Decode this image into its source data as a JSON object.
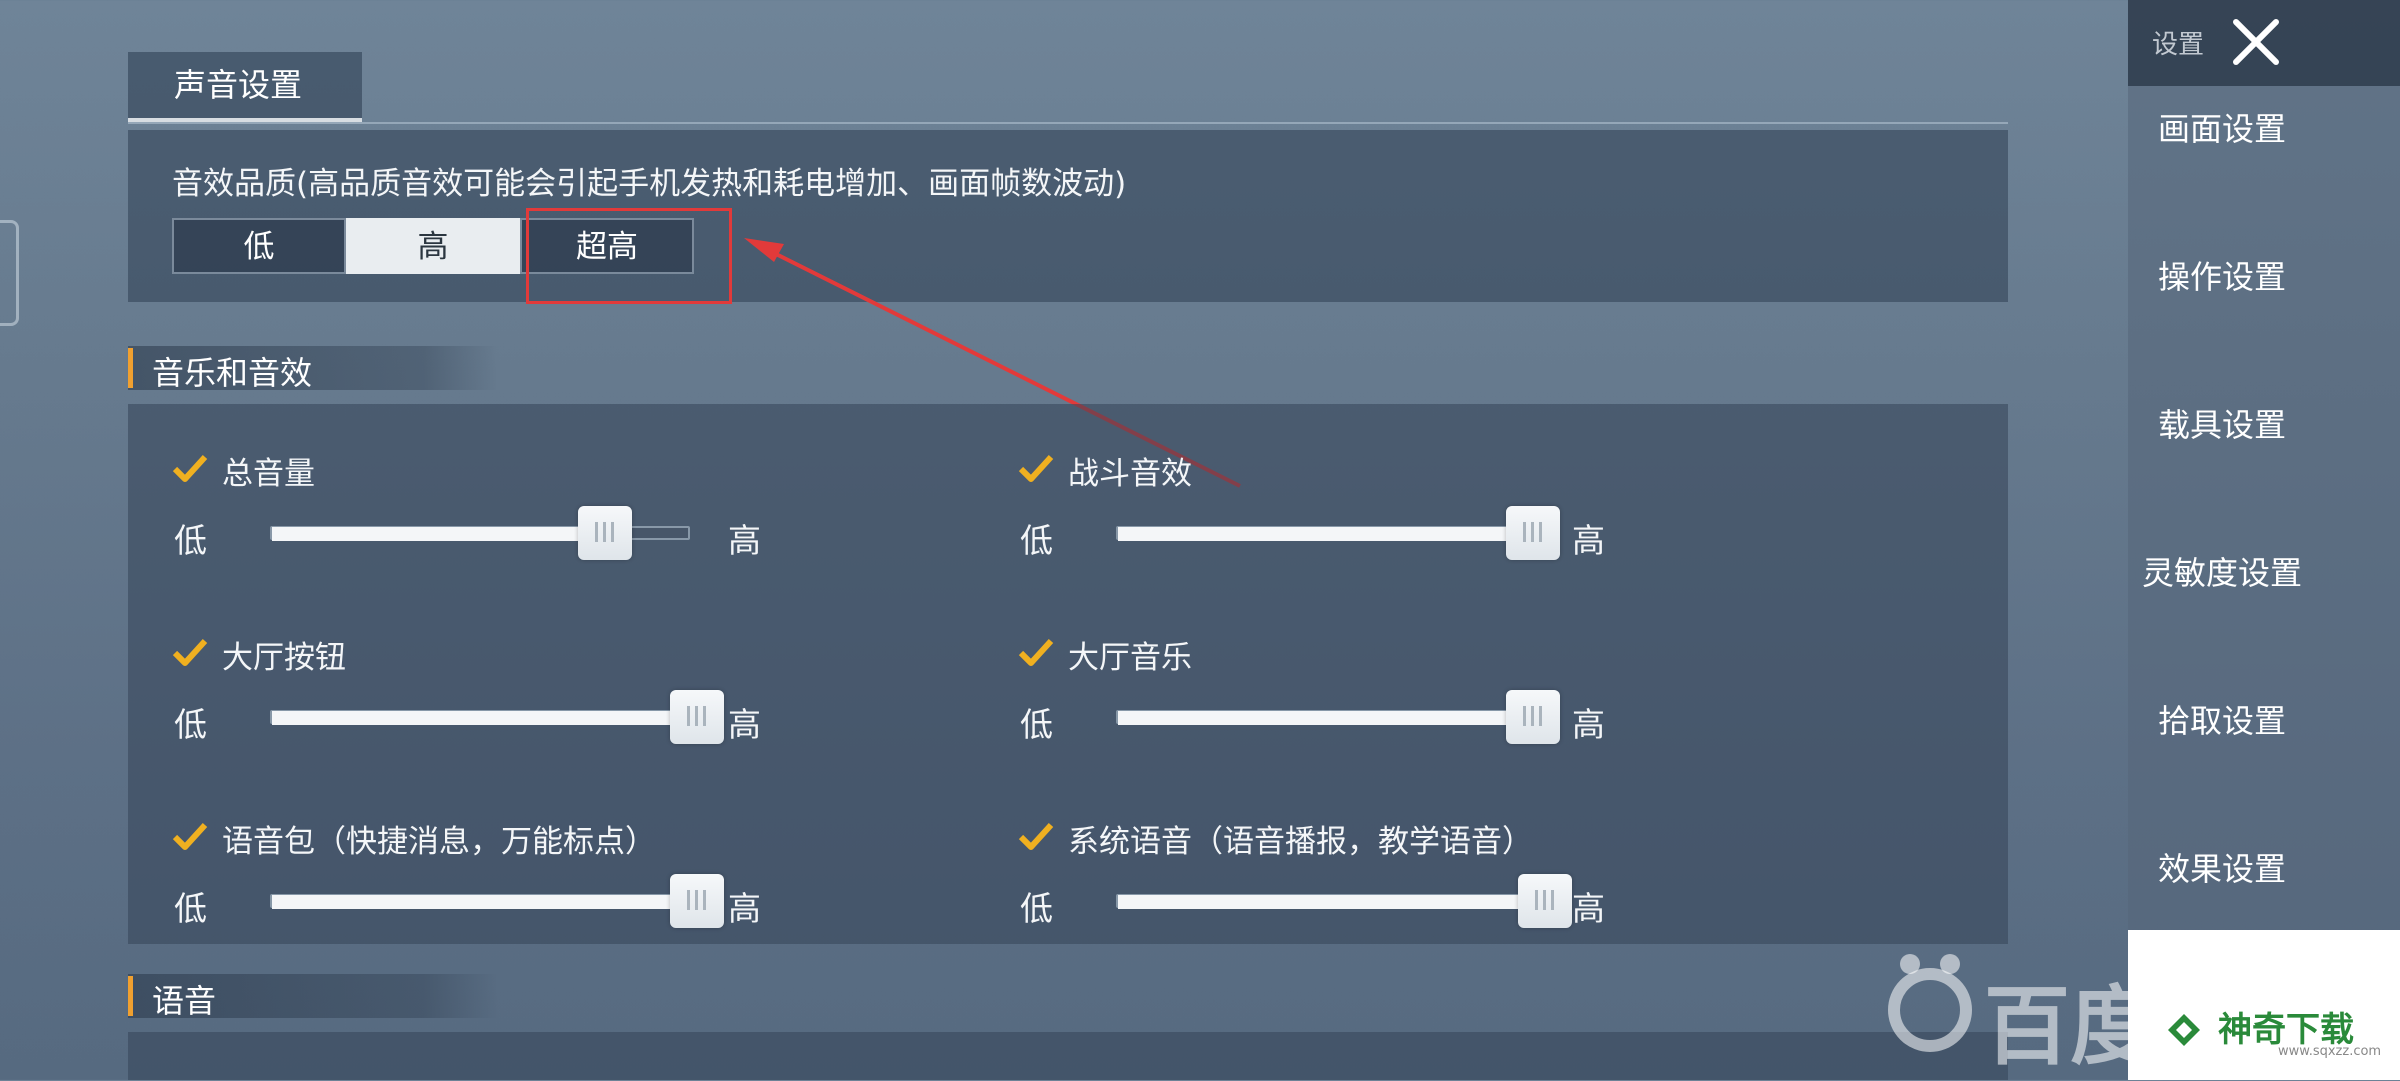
{
  "top_tab": {
    "label": "声音设置"
  },
  "quality": {
    "title": "音效品质(高品质音效可能会引起手机发热和耗电增加、画面帧数波动)",
    "options": [
      "低",
      "高",
      "超高"
    ],
    "selected": "高"
  },
  "sections": {
    "music": "音乐和音效",
    "voice": "语音"
  },
  "sliders": [
    {
      "label": "总音量",
      "low": "低",
      "high": "高",
      "value": 0.79,
      "checked": true
    },
    {
      "label": "战斗音效",
      "low": "低",
      "high": "高",
      "value": 1.0,
      "checked": true
    },
    {
      "label": "大厅按钮",
      "low": "低",
      "high": "高",
      "value": 1.0,
      "checked": true
    },
    {
      "label": "大厅音乐",
      "low": "低",
      "high": "高",
      "value": 1.0,
      "checked": true
    },
    {
      "label": "语音包（快捷消息，万能标点）",
      "low": "低",
      "high": "高",
      "value": 1.0,
      "checked": true
    },
    {
      "label": "系统语音（语音播报，教学语音）",
      "low": "低",
      "high": "高",
      "value": 1.0,
      "checked": true
    }
  ],
  "nav": {
    "top_label": "设置",
    "close_icon": "close-icon",
    "items": [
      "画面设置",
      "操作设置",
      "载具设置",
      "灵敏度设置",
      "拾取设置",
      "效果设置"
    ]
  },
  "watermarks": {
    "baidu": "百度",
    "shenqi": "神奇下载",
    "shenqi_url": "www.sqxzz.com"
  },
  "colors": {
    "accent": "#f0a030",
    "annotation": "#e23a3a",
    "check": "#f0b020"
  }
}
